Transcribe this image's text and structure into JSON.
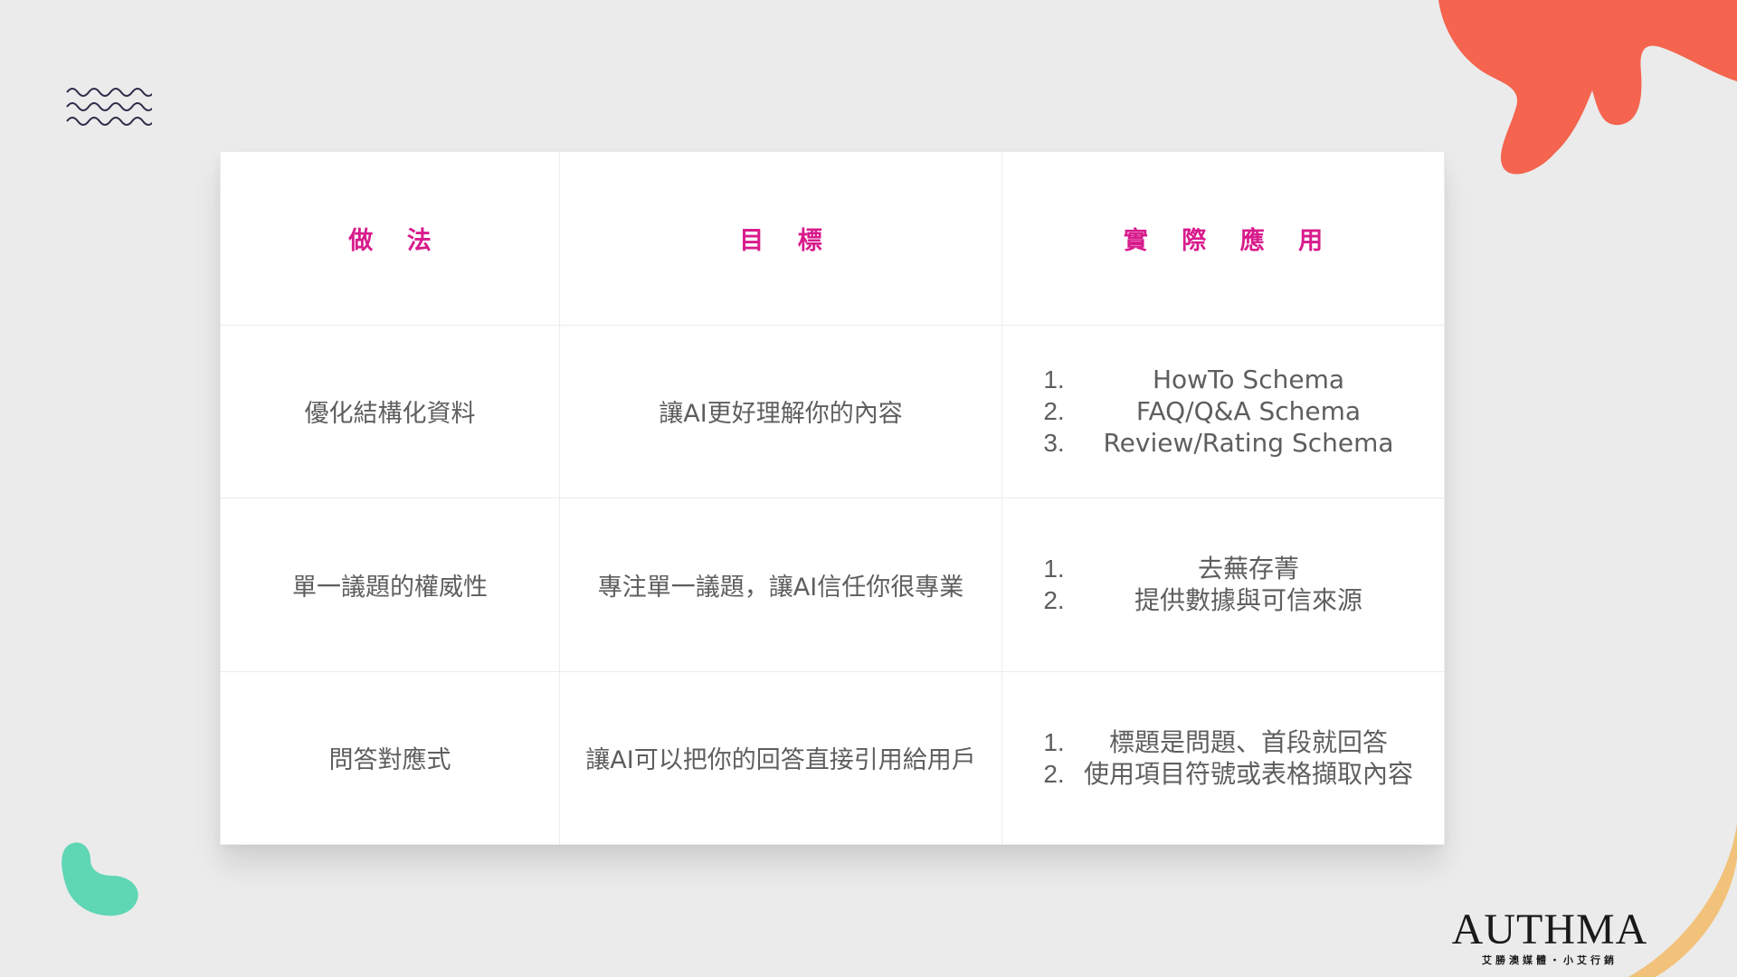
{
  "table": {
    "headers": [
      "做 法",
      "目 標",
      "實 際 應 用"
    ],
    "rows": [
      {
        "method": "優化結構化資料",
        "goal": "讓AI更好理解你的內容",
        "applications": [
          "HowTo Schema",
          "FAQ/Q&A Schema",
          "Review/Rating Schema"
        ]
      },
      {
        "method": "單一議題的權威性",
        "goal": "專注單一議題，讓AI信任你很專業",
        "applications": [
          "去蕪存菁",
          "提供數據與可信來源"
        ]
      },
      {
        "method": "問答對應式",
        "goal": "讓AI可以把你的回答直接引用給用戶",
        "applications": [
          "標題是問題、首段就回答",
          "使用項目符號或表格擷取內容"
        ]
      }
    ],
    "list_numbers": [
      "1.",
      "2.",
      "3."
    ]
  },
  "logo": {
    "wordmark": "AUTHMA",
    "tagline": "艾勝澳媒體・小艾行銷"
  },
  "colors": {
    "background": "#ebebeb",
    "header_text": "#d81b8c",
    "body_text": "#5e5e5e",
    "coral_blob": "#f4644f",
    "mint_leaf": "#5fd6b4",
    "gold_arc": "#f2c27a",
    "wave_lines": "#2d2d4a"
  }
}
